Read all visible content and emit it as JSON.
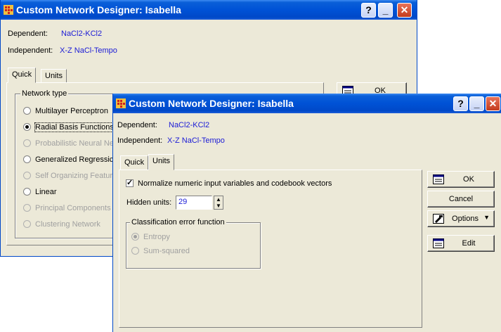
{
  "back_window": {
    "title": "Custom Network Designer: Isabella",
    "dependent_label": "Dependent:",
    "dependent_value": "NaCl2-KCl2",
    "independent_label": "Independent:",
    "independent_value": "X-Z NaCl-Tempo",
    "tabs": [
      "Quick",
      "Units"
    ],
    "ok_label": "OK",
    "network_type": {
      "title": "Network type",
      "options": [
        {
          "label": "Multilayer Perceptron",
          "selected": false,
          "enabled": true
        },
        {
          "label": "Radial Basis Functions",
          "selected": true,
          "enabled": true
        },
        {
          "label": "Probabilistic Neural Ne",
          "selected": false,
          "enabled": false
        },
        {
          "label": "Generalized Regressic",
          "selected": false,
          "enabled": true
        },
        {
          "label": "Self Organizing Featur",
          "selected": false,
          "enabled": false
        },
        {
          "label": "Linear",
          "selected": false,
          "enabled": true
        },
        {
          "label": "Principal Components",
          "selected": false,
          "enabled": false
        },
        {
          "label": "Clustering Network",
          "selected": false,
          "enabled": false
        }
      ]
    }
  },
  "front_window": {
    "title": "Custom Network Designer: Isabella",
    "dependent_label": "Dependent:",
    "dependent_value": "NaCl2-KCl2",
    "independent_label": "Independent:",
    "independent_value": "X-Z NaCl-Tempo",
    "tabs": [
      "Quick",
      "Units"
    ],
    "active_tab": "Units",
    "normalize_label": "Normalize numeric input variables and codebook vectors",
    "normalize_checked": true,
    "hidden_units_label": "Hidden units:",
    "hidden_units_value": "29",
    "classification": {
      "title": "Classification error function",
      "options": [
        {
          "label": "Entropy",
          "selected": true,
          "enabled": false
        },
        {
          "label": "Sum-squared",
          "selected": false,
          "enabled": false
        }
      ]
    },
    "buttons": {
      "ok": "OK",
      "cancel": "Cancel",
      "options": "Options",
      "edit": "Edit"
    }
  },
  "title_buttons": {
    "help": "?",
    "minimize": "_",
    "close": "✕"
  }
}
